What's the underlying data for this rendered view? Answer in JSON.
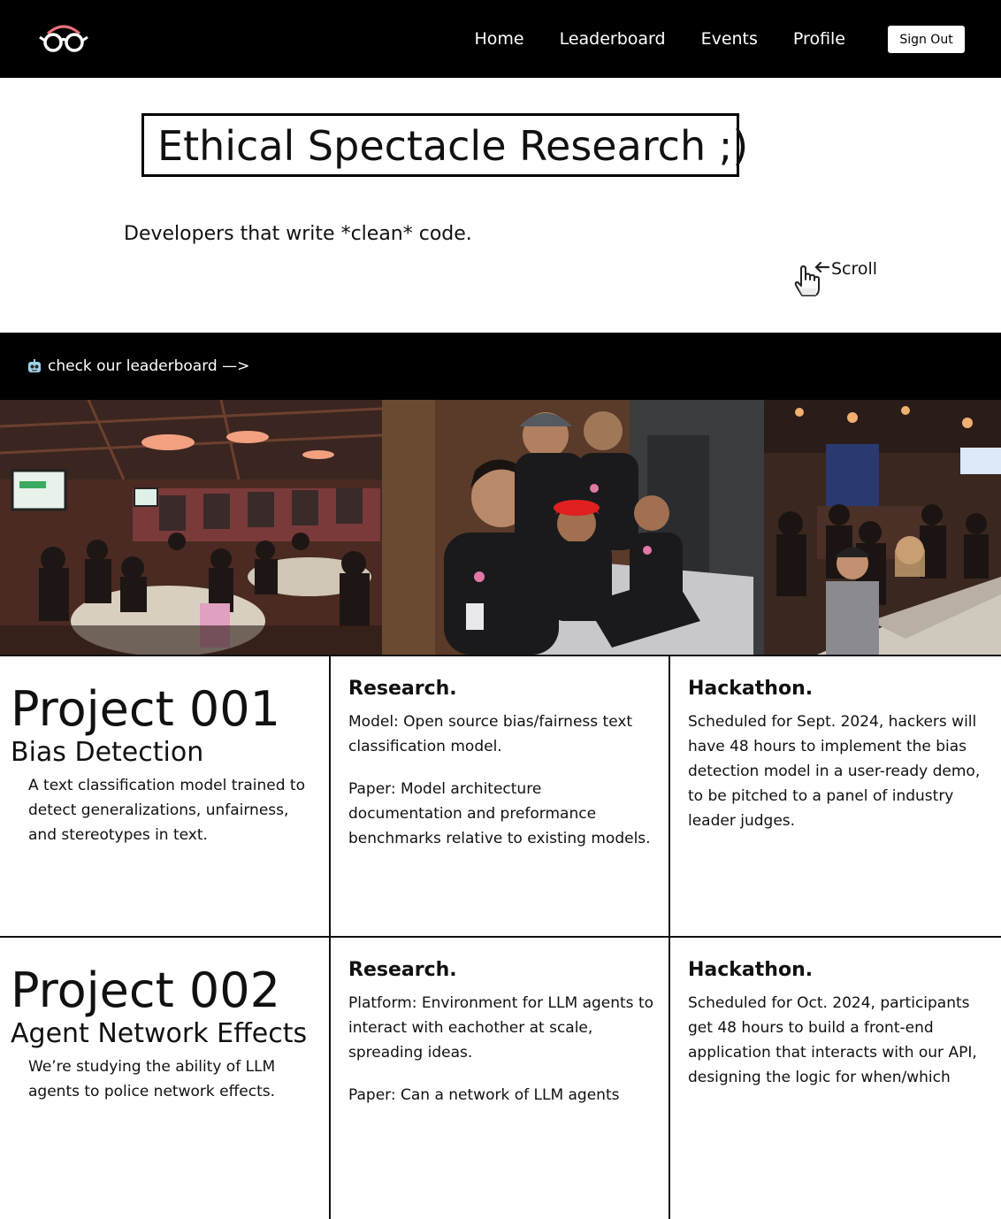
{
  "nav": {
    "links": [
      "Home",
      "Leaderboard",
      "Events",
      "Profile"
    ],
    "signout_label": "Sign Out"
  },
  "hero": {
    "title": "Ethical Spectacle Research ;)",
    "subtitle": "Developers that write *clean* code.",
    "scroll_label": "Scroll"
  },
  "banner": {
    "link_text": "check our leaderboard —>"
  },
  "photos": [
    "conference-hall-photo",
    "team-coding-photo",
    "audience-photo"
  ],
  "projects": [
    {
      "title": "Project 001",
      "subtitle": "Bias Detection",
      "description": "A text classification model trained to detect generalizations, unfairness, and stereotypes in text.",
      "research_heading": "Research.",
      "research_p1": "Model: Open source bias/fairness text classification model.",
      "research_p2": "Paper: Model architecture documentation and preformance benchmarks relative to existing models.",
      "hackathon_heading": "Hackathon.",
      "hackathon_p1": "Scheduled for Sept. 2024, hackers will have 48 hours to implement the bias detection model in a user-ready demo, to be pitched to a panel of industry leader judges."
    },
    {
      "title": "Project 002",
      "subtitle": "Agent Network Effects",
      "description": "We’re studying the ability of LLM agents to police network effects.",
      "research_heading": "Research.",
      "research_p1": "Platform: Environment for LLM agents to interact with eachother at scale, spreading ideas.",
      "research_p2": "Paper: Can a network of LLM agents",
      "hackathon_heading": "Hackathon.",
      "hackathon_p1": "Scheduled for Oct. 2024, participants get 48 hours to build a front-end application that interacts with our API, designing the logic for when/which"
    }
  ],
  "colors": {
    "nav_bg": "#000000",
    "banner_bg": "#000000",
    "logo_accent": "#e8707a"
  }
}
